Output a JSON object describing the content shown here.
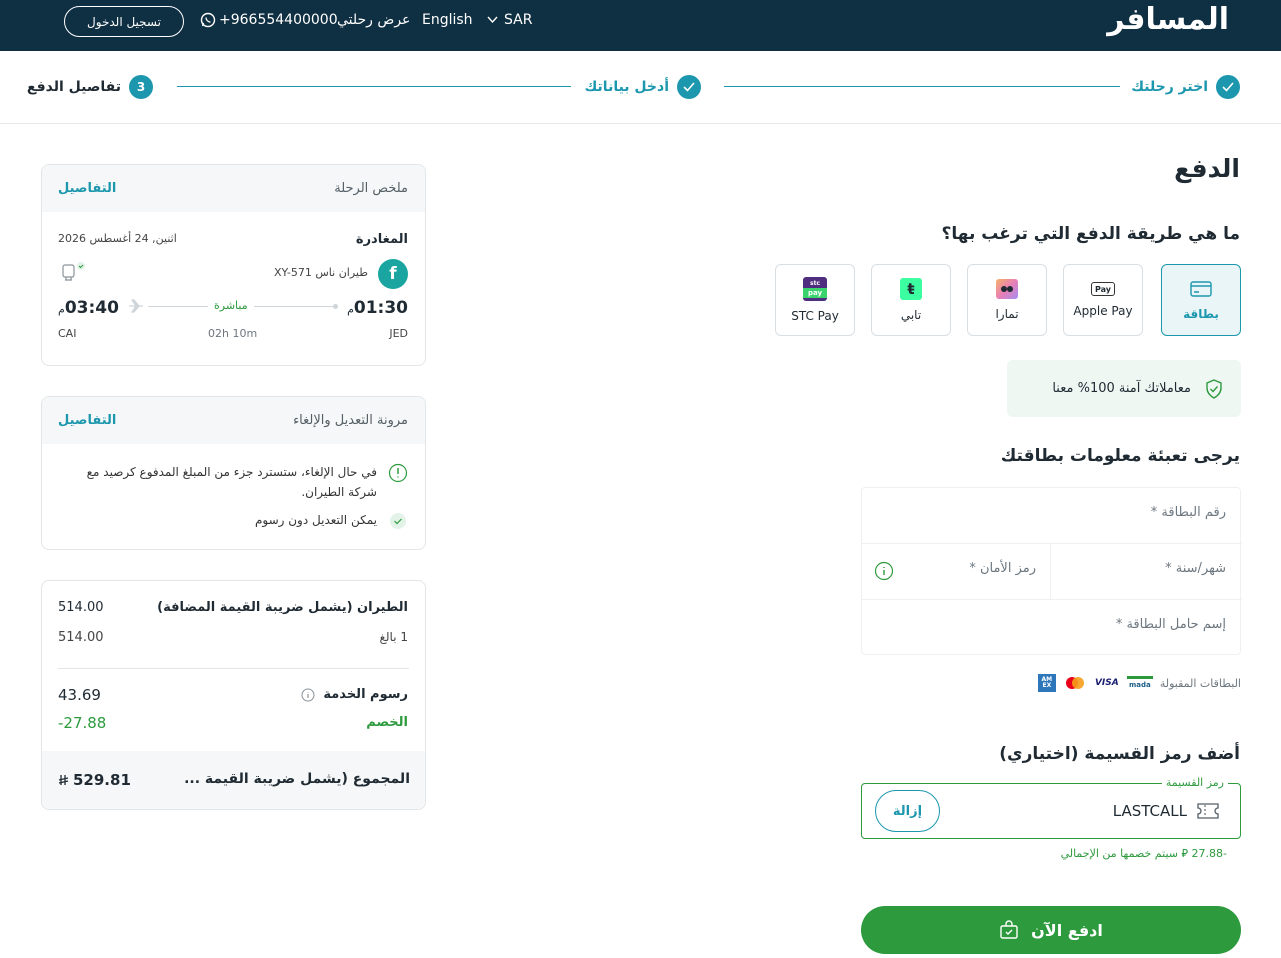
{
  "header": {
    "logo": "المسافر",
    "currency": "SAR",
    "language": "English",
    "my_trip": "عرض رحلتي",
    "phone": "+966554400000",
    "login": "تسجيل الدخول"
  },
  "stepper": {
    "steps": [
      {
        "number": "",
        "label": "اختر رحلتك"
      },
      {
        "number": "",
        "label": "أدخل بياناتك"
      },
      {
        "number": "3",
        "label": "تفاصيل الدفع"
      }
    ]
  },
  "payment": {
    "title": "الدفع",
    "method_question": "ما هي طريقة الدفع التي ترغب بها؟",
    "methods": [
      {
        "label": "بطاقة",
        "icon": "card-icon"
      },
      {
        "label": "Apple Pay",
        "icon": "apple-pay-icon"
      },
      {
        "label": "تمارا",
        "icon": "tamara-icon"
      },
      {
        "label": "تابي",
        "icon": "tabby-icon"
      },
      {
        "label": "STC Pay",
        "icon": "stc-pay-icon"
      }
    ],
    "stc_logo_top": "stc",
    "stc_logo_bottom": "pay",
    "apple_logo": "Pay",
    "tabby_logo": "ŧ",
    "secure_text": "معاملاتك آمنة 100% معنا",
    "card_question": "يرجى تعبئة معلومات بطاقتك",
    "fields": {
      "card_number": "رقم البطاقة *",
      "expiry": "شهر/سنة *",
      "cvv": "رمز الأمان *",
      "holder": "إسم حامل البطاقة *"
    },
    "accepted_label": "البطاقات المقبولة",
    "accepted_cards": [
      "mada",
      "VISA",
      "Mastercard",
      "AMEX"
    ],
    "mada_logo": "mada",
    "visa_logo": "VISA",
    "amex_logo": "AM EX",
    "coupon_question": "أضف رمز القسيمة (اختياري)",
    "coupon_legend": "رمز القسيمة",
    "coupon_code": "LASTCALL",
    "remove_label": "إزالة",
    "discount_note": "-27.88 ⃁ سيتم خصمها من الإجمالي",
    "pay_button": "ادفع الآن"
  },
  "summary": {
    "title": "ملخص الرحلة",
    "details_link": "التفاصيل",
    "departure_label": "المغادرة",
    "date": "اثنين, 24 أغسطس 2026",
    "airline_logo": "f",
    "airline": "طيران ناس XY-571",
    "dep_time": "01:30",
    "dep_suffix": "م",
    "arr_time": "03:40",
    "arr_suffix": "م",
    "stops": "مباشرة",
    "duration": "02h 10m",
    "from": "JED",
    "to": "CAI"
  },
  "flex": {
    "title": "مرونة التعديل والإلغاء",
    "details_link": "التفاصيل",
    "cancel_note": "في حال الإلغاء، ستسترد جزء من المبلغ المدفوع كرصيد مع شركة الطيران.",
    "change_note": "يمكن التعديل دون رسوم"
  },
  "price": {
    "flight_label": "الطيران (يشمل ضريبة القيمة المضافة)",
    "flight_value": "514.00",
    "adult_label": "1 بالغ",
    "adult_value": "514.00",
    "service_label": "رسوم الخدمة",
    "service_value": "43.69",
    "discount_label": "الخصم",
    "discount_value": "-27.88",
    "total_label": "المجموع (يشمل ضريبة القيمة ...",
    "total_value": "529.81"
  },
  "colors": {
    "header_bg": "#0f2f42",
    "accent": "#1c97ad",
    "success": "#2d9a3e"
  }
}
